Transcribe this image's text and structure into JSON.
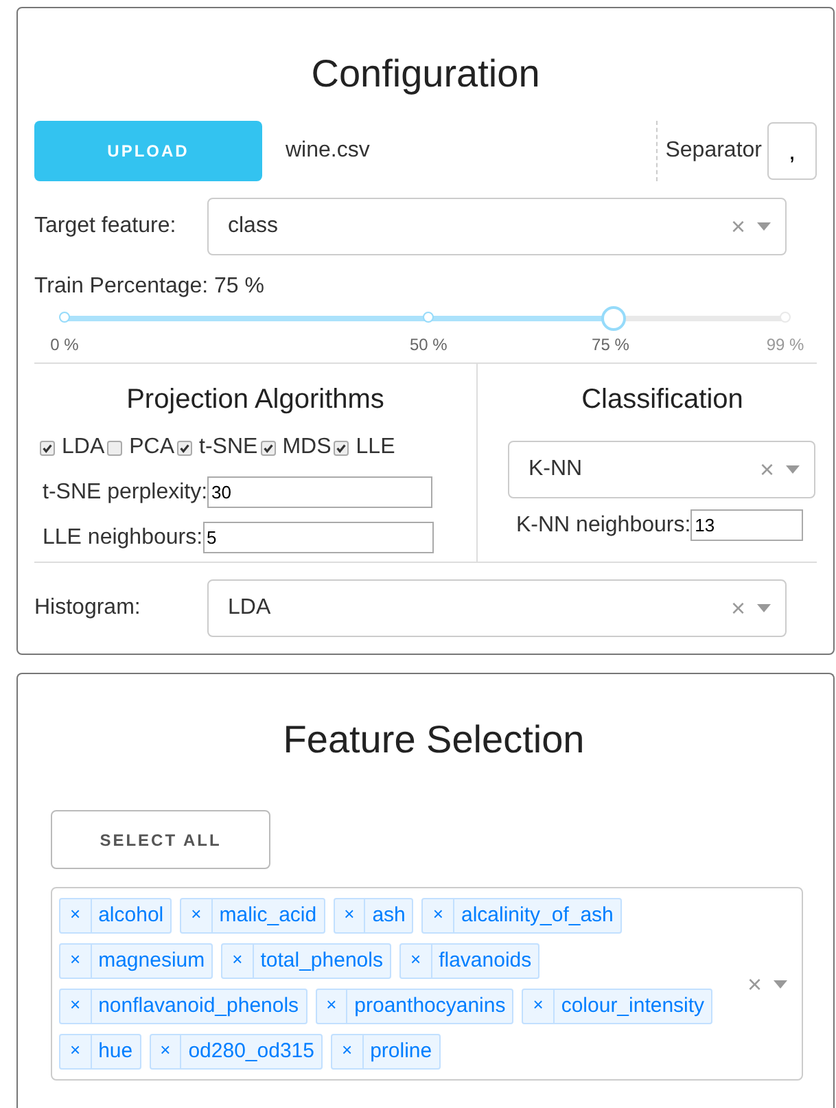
{
  "configuration": {
    "title": "Configuration",
    "upload_button": "UPLOAD",
    "file_name": "wine.csv",
    "separator": {
      "label": "Separator",
      "value": ","
    },
    "target_feature": {
      "label": "Target feature:",
      "value": "class",
      "clear": "×"
    },
    "train_percentage": {
      "label": "Train Percentage: 75 %",
      "level": 0.76,
      "marks": [
        "0 %",
        "50 %",
        "75 %",
        "99 %"
      ]
    },
    "projection": {
      "title": "Projection Algorithms",
      "algorithms": [
        {
          "label": "LDA",
          "checked": true
        },
        {
          "label": "PCA",
          "checked": false
        },
        {
          "label": "t-SNE",
          "checked": true
        },
        {
          "label": "MDS",
          "checked": true
        },
        {
          "label": "LLE",
          "checked": true
        }
      ],
      "fields": [
        {
          "label": "t-SNE perplexity:",
          "value": "30"
        },
        {
          "label": "LLE neighbours:",
          "value": "5"
        }
      ]
    },
    "classification": {
      "title": "Classification",
      "value": "K-NN",
      "clear": "×",
      "field": {
        "label": "K-NN neighbours:",
        "value": "13"
      }
    },
    "histogram": {
      "label": "Histogram:",
      "value": "LDA",
      "clear": "×"
    }
  },
  "feature_selection": {
    "title": "Feature Selection",
    "select_all": "SELECT ALL",
    "clear": "×",
    "tags": [
      {
        "label": "alcohol",
        "remove": "×"
      },
      {
        "label": "malic_acid",
        "remove": "×"
      },
      {
        "label": "ash",
        "remove": "×"
      },
      {
        "label": "alcalinity_of_ash",
        "remove": "×"
      },
      {
        "label": "magnesium",
        "remove": "×"
      },
      {
        "label": "total_phenols",
        "remove": "×"
      },
      {
        "label": "flavanoids",
        "remove": "×"
      },
      {
        "label": "nonflavanoid_phenols",
        "remove": "×"
      },
      {
        "label": "proanthocyanins",
        "remove": "×"
      },
      {
        "label": "colour_intensity",
        "remove": "×"
      },
      {
        "label": "hue",
        "remove": "×"
      },
      {
        "label": "od280_od315",
        "remove": "×"
      },
      {
        "label": "proline",
        "remove": "×"
      }
    ]
  }
}
